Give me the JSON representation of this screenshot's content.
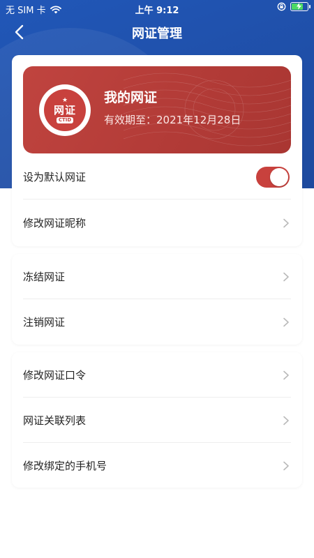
{
  "status_bar": {
    "carrier": "无 SIM 卡",
    "time": "上午 9:12",
    "battery_level": 0.75
  },
  "nav": {
    "title": "网证管理",
    "back_icon": "chevron-left-icon"
  },
  "id_card": {
    "badge_title": "网证",
    "badge_sub": "CTID",
    "name": "我的网证",
    "validity": "有效期至：2021年12月28日"
  },
  "settings": {
    "default_label": "设为默认网证",
    "default_enabled": true
  },
  "group1": [
    {
      "label": "修改网证昵称"
    }
  ],
  "group2": [
    {
      "label": "冻结网证"
    },
    {
      "label": "注销网证"
    }
  ],
  "group3": [
    {
      "label": "修改网证口令"
    },
    {
      "label": "网证关联列表"
    },
    {
      "label": "修改绑定的手机号"
    }
  ],
  "colors": {
    "header_blue": "#2157b8",
    "card_red": "#c0443f",
    "toggle_red": "#c8413d"
  }
}
